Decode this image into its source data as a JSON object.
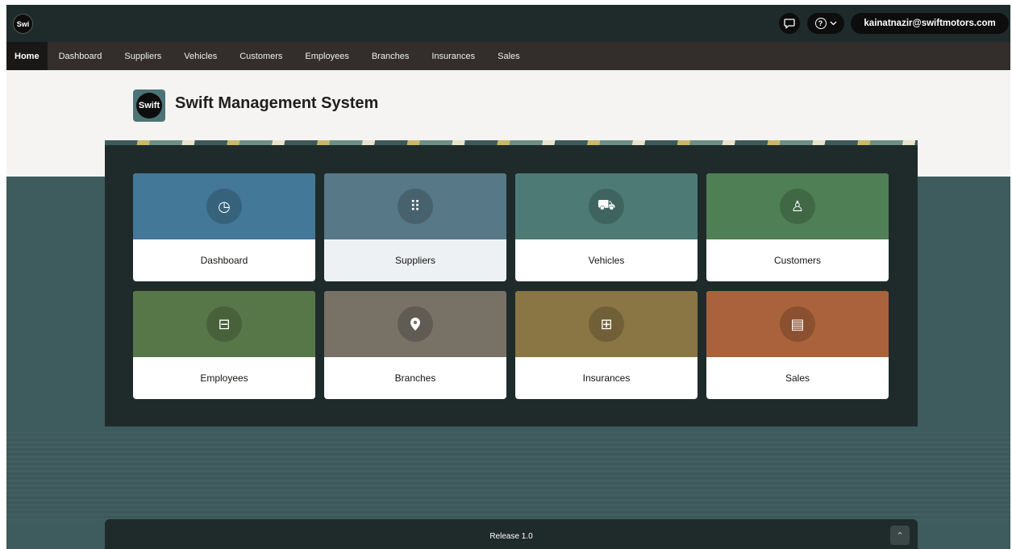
{
  "header": {
    "logo_text": "Swi",
    "user_email": "kainatnazir@swiftmotors.com",
    "help_glyph": "?",
    "icons": [
      "chat-icon",
      "help-icon",
      "user-icon",
      "chevron-down-icon"
    ]
  },
  "nav": {
    "items": [
      {
        "label": "Home",
        "active": true
      },
      {
        "label": "Dashboard"
      },
      {
        "label": "Suppliers"
      },
      {
        "label": "Vehicles"
      },
      {
        "label": "Customers"
      },
      {
        "label": "Employees"
      },
      {
        "label": "Branches"
      },
      {
        "label": "Insurances"
      },
      {
        "label": "Sales"
      }
    ]
  },
  "hero": {
    "logo_text": "Swift",
    "title": "Swift Management System"
  },
  "tiles": [
    {
      "label": "Dashboard",
      "icon": "gauge-icon",
      "glyph": "◷",
      "color": "#437898"
    },
    {
      "label": "Suppliers",
      "icon": "grid-dots-icon",
      "glyph": "⠿",
      "color": "#577886"
    },
    {
      "label": "Vehicles",
      "icon": "car-icon",
      "glyph": "⛟",
      "color": "#4e7a76"
    },
    {
      "label": "Customers",
      "icon": "person-icon",
      "glyph": "♙",
      "color": "#4f7f55"
    },
    {
      "label": "Employees",
      "icon": "briefcase-icon",
      "glyph": "⊟",
      "color": "#587748"
    },
    {
      "label": "Branches",
      "icon": "location-pin-icon",
      "glyph": "⬤",
      "color": "#777166"
    },
    {
      "label": "Insurances",
      "icon": "table-icon",
      "glyph": "⊞",
      "color": "#8a7545"
    },
    {
      "label": "Sales",
      "icon": "form-pointer-icon",
      "glyph": "▤",
      "color": "#a9623b"
    }
  ],
  "footer": {
    "release": "Release 1.0",
    "scroll_glyph": "⌃"
  }
}
